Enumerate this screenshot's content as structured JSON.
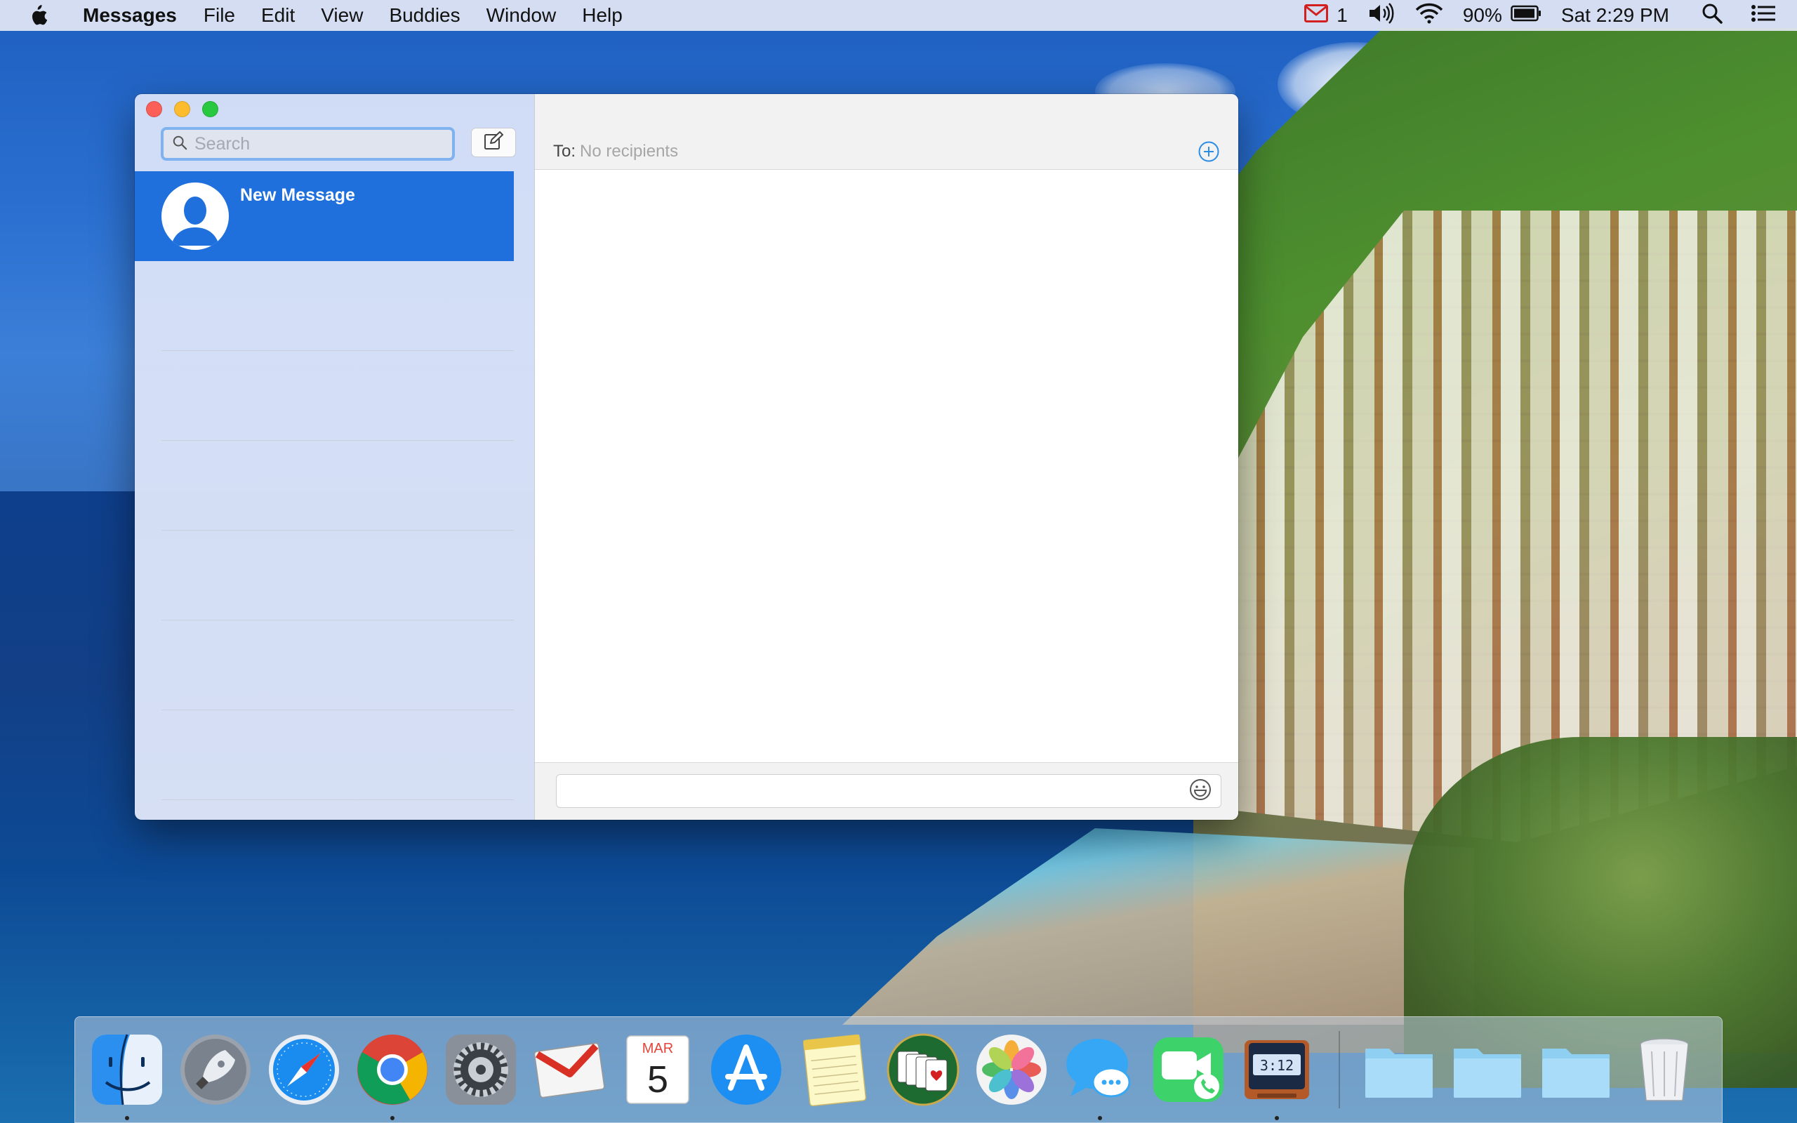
{
  "menubar": {
    "app_name": "Messages",
    "menus": [
      "File",
      "Edit",
      "View",
      "Buddies",
      "Window",
      "Help"
    ],
    "mail_count": "1",
    "battery": "90%",
    "clock": "Sat 2:29 PM",
    "icons": [
      "apple-icon",
      "mail-icon",
      "volume-icon",
      "wifi-icon",
      "battery-icon",
      "spotlight-icon",
      "notification-center-icon"
    ]
  },
  "window": {
    "search": {
      "placeholder": "Search",
      "value": ""
    },
    "conversations": [
      {
        "name": "New Message",
        "selected": true
      }
    ],
    "to": {
      "label": "To:",
      "placeholder": "No recipients"
    },
    "compose": {
      "placeholder": ""
    }
  },
  "dock": {
    "apps": [
      {
        "name": "Finder",
        "running": true
      },
      {
        "name": "Launchpad",
        "running": false
      },
      {
        "name": "Safari",
        "running": false
      },
      {
        "name": "Google Chrome",
        "running": true
      },
      {
        "name": "System Preferences",
        "running": false
      },
      {
        "name": "Mail",
        "running": false
      },
      {
        "name": "Calendar",
        "running": false,
        "month": "MAR",
        "day": "5"
      },
      {
        "name": "App Store",
        "running": false
      },
      {
        "name": "Notes",
        "running": false
      },
      {
        "name": "Solitaire",
        "running": false
      },
      {
        "name": "Photos",
        "running": false
      },
      {
        "name": "Messages",
        "running": true
      },
      {
        "name": "FaceTime",
        "running": false
      },
      {
        "name": "Clock",
        "running": true,
        "time": "3:12"
      }
    ],
    "folders": [
      "Folder 1",
      "Folder 2",
      "Folder 3"
    ],
    "trash": "Trash"
  },
  "colors": {
    "selection": "#1f6fdc",
    "accent": "#2a8ce6",
    "close": "#fc5f57",
    "minimize": "#fdbc2e",
    "maximize": "#28c840"
  }
}
